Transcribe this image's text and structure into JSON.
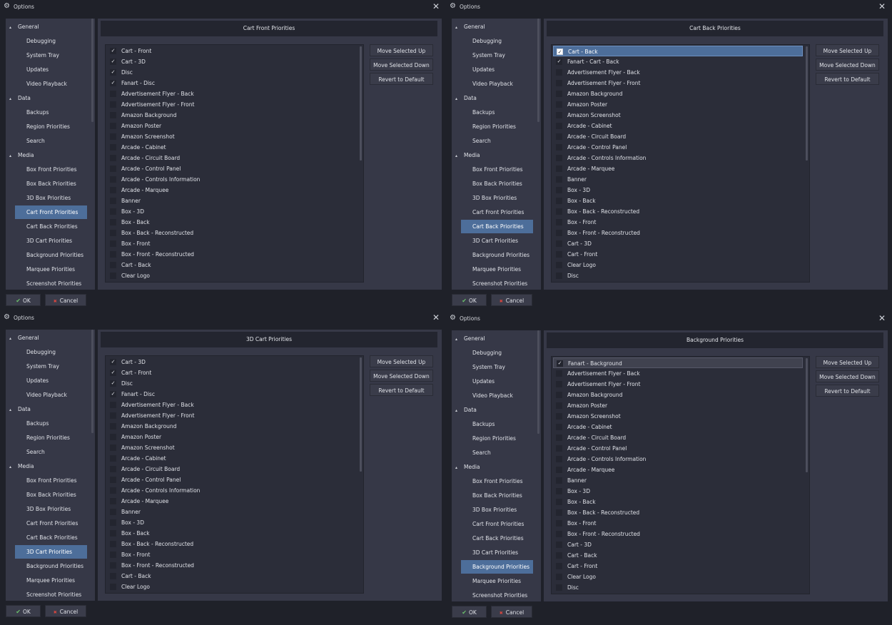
{
  "window": {
    "title": "Options",
    "close_symbol": "✕",
    "gear_symbol": "⚙"
  },
  "tree": {
    "triangle_symbol": "▴",
    "items": [
      {
        "label": "General",
        "kind": "cat"
      },
      {
        "label": "Debugging",
        "kind": "sub"
      },
      {
        "label": "System Tray",
        "kind": "sub"
      },
      {
        "label": "Updates",
        "kind": "sub"
      },
      {
        "label": "Video Playback",
        "kind": "sub"
      },
      {
        "label": "Data",
        "kind": "cat"
      },
      {
        "label": "Backups",
        "kind": "sub"
      },
      {
        "label": "Region Priorities",
        "kind": "sub"
      },
      {
        "label": "Search",
        "kind": "sub"
      },
      {
        "label": "Media",
        "kind": "cat"
      },
      {
        "label": "Box Front Priorities",
        "kind": "sub"
      },
      {
        "label": "Box Back Priorities",
        "kind": "sub"
      },
      {
        "label": "3D Box Priorities",
        "kind": "sub"
      },
      {
        "label": "Cart Front Priorities",
        "kind": "sub"
      },
      {
        "label": "Cart Back Priorities",
        "kind": "sub"
      },
      {
        "label": "3D Cart Priorities",
        "kind": "sub"
      },
      {
        "label": "Background Priorities",
        "kind": "sub"
      },
      {
        "label": "Marquee Priorities",
        "kind": "sub"
      },
      {
        "label": "Screenshot Priorities",
        "kind": "sub"
      }
    ]
  },
  "buttons": {
    "ok_label": "OK",
    "cancel_label": "Cancel",
    "move_up_label": "Move Selected Up",
    "move_down_label": "Move Selected Down",
    "revert_label": "Revert to Default",
    "check_symbol": "✔",
    "cancel_symbol": "✖"
  },
  "check_mark": "✓",
  "windows": [
    {
      "selected_tree": "Cart Front Priorities",
      "panel_title": "Cart Front Priorities",
      "items": [
        {
          "label": "Cart - Front",
          "checked": true
        },
        {
          "label": "Cart - 3D",
          "checked": true
        },
        {
          "label": "Disc",
          "checked": true
        },
        {
          "label": "Fanart - Disc",
          "checked": true
        },
        {
          "label": "Advertisement Flyer - Back",
          "checked": false
        },
        {
          "label": "Advertisement Flyer - Front",
          "checked": false
        },
        {
          "label": "Amazon Background",
          "checked": false
        },
        {
          "label": "Amazon Poster",
          "checked": false
        },
        {
          "label": "Amazon Screenshot",
          "checked": false
        },
        {
          "label": "Arcade - Cabinet",
          "checked": false
        },
        {
          "label": "Arcade - Circuit Board",
          "checked": false
        },
        {
          "label": "Arcade - Control Panel",
          "checked": false
        },
        {
          "label": "Arcade - Controls Information",
          "checked": false
        },
        {
          "label": "Arcade - Marquee",
          "checked": false
        },
        {
          "label": "Banner",
          "checked": false
        },
        {
          "label": "Box - 3D",
          "checked": false
        },
        {
          "label": "Box - Back",
          "checked": false
        },
        {
          "label": "Box - Back - Reconstructed",
          "checked": false
        },
        {
          "label": "Box - Front",
          "checked": false
        },
        {
          "label": "Box - Front - Reconstructed",
          "checked": false
        },
        {
          "label": "Cart - Back",
          "checked": false
        },
        {
          "label": "Clear Logo",
          "checked": false
        }
      ]
    },
    {
      "selected_tree": "Cart Back Priorities",
      "panel_title": "Cart Back Priorities",
      "items": [
        {
          "label": "Cart - Back",
          "checked": true,
          "selected": true
        },
        {
          "label": "Fanart - Cart - Back",
          "checked": true
        },
        {
          "label": "Advertisement Flyer - Back",
          "checked": false
        },
        {
          "label": "Advertisement Flyer - Front",
          "checked": false
        },
        {
          "label": "Amazon Background",
          "checked": false
        },
        {
          "label": "Amazon Poster",
          "checked": false
        },
        {
          "label": "Amazon Screenshot",
          "checked": false
        },
        {
          "label": "Arcade - Cabinet",
          "checked": false
        },
        {
          "label": "Arcade - Circuit Board",
          "checked": false
        },
        {
          "label": "Arcade - Control Panel",
          "checked": false
        },
        {
          "label": "Arcade - Controls Information",
          "checked": false
        },
        {
          "label": "Arcade - Marquee",
          "checked": false
        },
        {
          "label": "Banner",
          "checked": false
        },
        {
          "label": "Box - 3D",
          "checked": false
        },
        {
          "label": "Box - Back",
          "checked": false
        },
        {
          "label": "Box - Back - Reconstructed",
          "checked": false
        },
        {
          "label": "Box - Front",
          "checked": false
        },
        {
          "label": "Box - Front - Reconstructed",
          "checked": false
        },
        {
          "label": "Cart - 3D",
          "checked": false
        },
        {
          "label": "Cart - Front",
          "checked": false
        },
        {
          "label": "Clear Logo",
          "checked": false
        },
        {
          "label": "Disc",
          "checked": false
        }
      ]
    },
    {
      "selected_tree": "3D Cart Priorities",
      "panel_title": "3D Cart Priorities",
      "items": [
        {
          "label": "Cart - 3D",
          "checked": true
        },
        {
          "label": "Cart - Front",
          "checked": true
        },
        {
          "label": "Disc",
          "checked": true
        },
        {
          "label": "Fanart - Disc",
          "checked": true
        },
        {
          "label": "Advertisement Flyer - Back",
          "checked": false
        },
        {
          "label": "Advertisement Flyer - Front",
          "checked": false
        },
        {
          "label": "Amazon Background",
          "checked": false
        },
        {
          "label": "Amazon Poster",
          "checked": false
        },
        {
          "label": "Amazon Screenshot",
          "checked": false
        },
        {
          "label": "Arcade - Cabinet",
          "checked": false
        },
        {
          "label": "Arcade - Circuit Board",
          "checked": false
        },
        {
          "label": "Arcade - Control Panel",
          "checked": false
        },
        {
          "label": "Arcade - Controls Information",
          "checked": false
        },
        {
          "label": "Arcade - Marquee",
          "checked": false
        },
        {
          "label": "Banner",
          "checked": false
        },
        {
          "label": "Box - 3D",
          "checked": false
        },
        {
          "label": "Box - Back",
          "checked": false
        },
        {
          "label": "Box - Back - Reconstructed",
          "checked": false
        },
        {
          "label": "Box - Front",
          "checked": false
        },
        {
          "label": "Box - Front - Reconstructed",
          "checked": false
        },
        {
          "label": "Cart - Back",
          "checked": false
        },
        {
          "label": "Clear Logo",
          "checked": false
        }
      ]
    },
    {
      "selected_tree": "Background Priorities",
      "panel_title": "Background Priorities",
      "items": [
        {
          "label": "Fanart - Background",
          "checked": true,
          "highlight": true
        },
        {
          "label": "Advertisement Flyer - Back",
          "checked": false
        },
        {
          "label": "Advertisement Flyer - Front",
          "checked": false
        },
        {
          "label": "Amazon Background",
          "checked": false
        },
        {
          "label": "Amazon Poster",
          "checked": false
        },
        {
          "label": "Amazon Screenshot",
          "checked": false
        },
        {
          "label": "Arcade - Cabinet",
          "checked": false
        },
        {
          "label": "Arcade - Circuit Board",
          "checked": false
        },
        {
          "label": "Arcade - Control Panel",
          "checked": false
        },
        {
          "label": "Arcade - Controls Information",
          "checked": false
        },
        {
          "label": "Arcade - Marquee",
          "checked": false
        },
        {
          "label": "Banner",
          "checked": false
        },
        {
          "label": "Box - 3D",
          "checked": false
        },
        {
          "label": "Box - Back",
          "checked": false
        },
        {
          "label": "Box - Back - Reconstructed",
          "checked": false
        },
        {
          "label": "Box - Front",
          "checked": false
        },
        {
          "label": "Box - Front - Reconstructed",
          "checked": false
        },
        {
          "label": "Cart - 3D",
          "checked": false
        },
        {
          "label": "Cart - Back",
          "checked": false
        },
        {
          "label": "Cart - Front",
          "checked": false
        },
        {
          "label": "Clear Logo",
          "checked": false
        },
        {
          "label": "Disc",
          "checked": false
        }
      ]
    }
  ]
}
